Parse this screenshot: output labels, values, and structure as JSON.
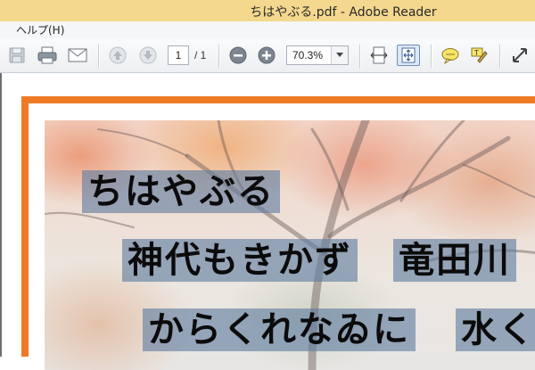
{
  "window": {
    "title": "ちはやぶる.pdf - Adobe Reader"
  },
  "menubar": {
    "items": [
      {
        "label": "ヘルプ(H)"
      }
    ]
  },
  "toolbar": {
    "page_current": "1",
    "page_total": "/ 1",
    "zoom_value": "70.3%",
    "icons": [
      "save-icon",
      "print-icon",
      "email-icon",
      "previous-page-icon",
      "next-page-icon",
      "zoom-out-icon",
      "zoom-in-icon",
      "fit-width-icon",
      "fit-page-icon",
      "comment-icon",
      "highlight-icon",
      "expand-icon"
    ]
  },
  "document": {
    "poem_lines": [
      {
        "text": "ちはやぶる"
      },
      {
        "text": "神代もきかず"
      },
      {
        "text": "竜田川"
      },
      {
        "text": "からくれなゐに"
      },
      {
        "text": "水く"
      }
    ]
  },
  "colors": {
    "titlebar": "#f4d88e",
    "page_border": "#ef7a25",
    "text_band": "#5f7da0"
  }
}
